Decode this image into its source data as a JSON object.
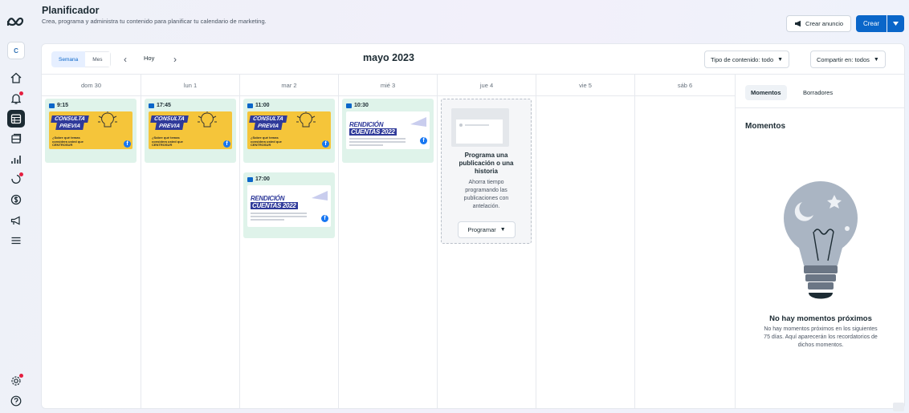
{
  "header": {
    "title": "Planificador",
    "subtitle": "Crea, programa y administra tu contenido para planificar tu calendario de marketing.",
    "create_ad_label": "Crear anuncio",
    "create_label": "Crear"
  },
  "rail": {
    "account_initial": "C",
    "items": [
      "home",
      "notifications",
      "planner",
      "content",
      "insights",
      "ads",
      "monetization",
      "campaigns",
      "menu",
      "settings",
      "help"
    ]
  },
  "toolbar": {
    "view_week": "Semana",
    "view_month": "Mes",
    "today": "Hoy",
    "month_label": "mayo 2023",
    "content_filter": "Tipo de contenido: todo",
    "shared_filter": "Compartir en: todos"
  },
  "calendar": {
    "days": [
      "dom 30",
      "lun 1",
      "mar 2",
      "mié 3",
      "jue 4",
      "vie 5",
      "sáb 6"
    ],
    "posts": [
      {
        "day": 0,
        "time": "9:15",
        "kind": "consulta"
      },
      {
        "day": 1,
        "time": "17:45",
        "kind": "consulta"
      },
      {
        "day": 2,
        "time": "11:00",
        "kind": "consulta"
      },
      {
        "day": 3,
        "time": "10:30",
        "kind": "rendicion"
      },
      {
        "day": 2,
        "time": "17:00",
        "kind": "rendicion"
      }
    ],
    "consulta": {
      "line1": "CONSULTA",
      "line2": "PREVIA",
      "tagline": "¿Sobre qué temas considera usted que CENTROSUR"
    },
    "rendicion": {
      "line1": "RENDICIÓN",
      "line2": "CUENTAS 2022"
    },
    "placeholder": {
      "title": "Programa una publicación o una historia",
      "description": "Ahorra tiempo programando las publicaciones con antelación.",
      "button": "Programar"
    }
  },
  "side_panel": {
    "tab_moments": "Momentos",
    "tab_drafts": "Borradores",
    "heading": "Momentos",
    "empty_title": "No hay momentos próximos",
    "empty_description": "No hay momentos próximos en los siguientes 75 días. Aquí aparecerán los recordatorios de dichos momentos."
  },
  "colors": {
    "primary": "#0a66c9",
    "card_bg": "#dff3ea",
    "banner_yellow": "#f5c53a",
    "banner_navy": "#2f3a9a",
    "facebook": "#1877f2"
  }
}
